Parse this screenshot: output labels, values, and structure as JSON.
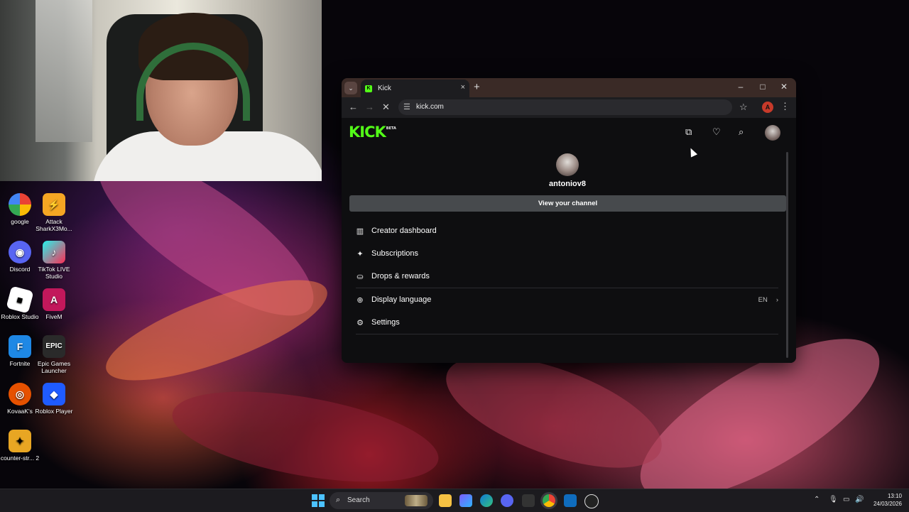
{
  "desktop_icons": [
    {
      "label": "google",
      "color": "#db4437"
    },
    {
      "label": "Attack SharkX3Mo...",
      "color": "#f5a623"
    },
    {
      "label": "Discord",
      "color": "#5865f2"
    },
    {
      "label": "TikTok LIVE Studio",
      "color": "#fe2c55"
    },
    {
      "label": "Roblox Studio",
      "color": "#1e1e1e"
    },
    {
      "label": "FiveM",
      "color": "#c2185b"
    },
    {
      "label": "Fortnite",
      "color": "#1e88e5"
    },
    {
      "label": "Epic Games Launcher",
      "color": "#2a2a2a",
      "glyph": "EPIC"
    },
    {
      "label": "KovaaK's",
      "color": "#e65100"
    },
    {
      "label": "Roblox Player",
      "color": "#1f5bff"
    },
    {
      "label": "counter-str... 2",
      "color": "#e8a623"
    }
  ],
  "browser": {
    "tab_title": "Kick",
    "tab_close": "×",
    "new_tab": "+",
    "url": "kick.com",
    "profile_initial": "A",
    "window_controls": {
      "minimize": "–",
      "maximize": "□",
      "close": "✕"
    }
  },
  "kick": {
    "logo": "KICK",
    "logo_badge": "BETA",
    "username": "antoniov8",
    "view_channel": "View your channel",
    "menu": {
      "creator_dashboard": "Creator dashboard",
      "subscriptions": "Subscriptions",
      "drops_rewards": "Drops & rewards",
      "display_language": "Display language",
      "display_language_value": "EN",
      "settings": "Settings"
    }
  },
  "taskbar": {
    "search_placeholder": "Search",
    "time": "13:10",
    "date": "24/03/2026"
  }
}
